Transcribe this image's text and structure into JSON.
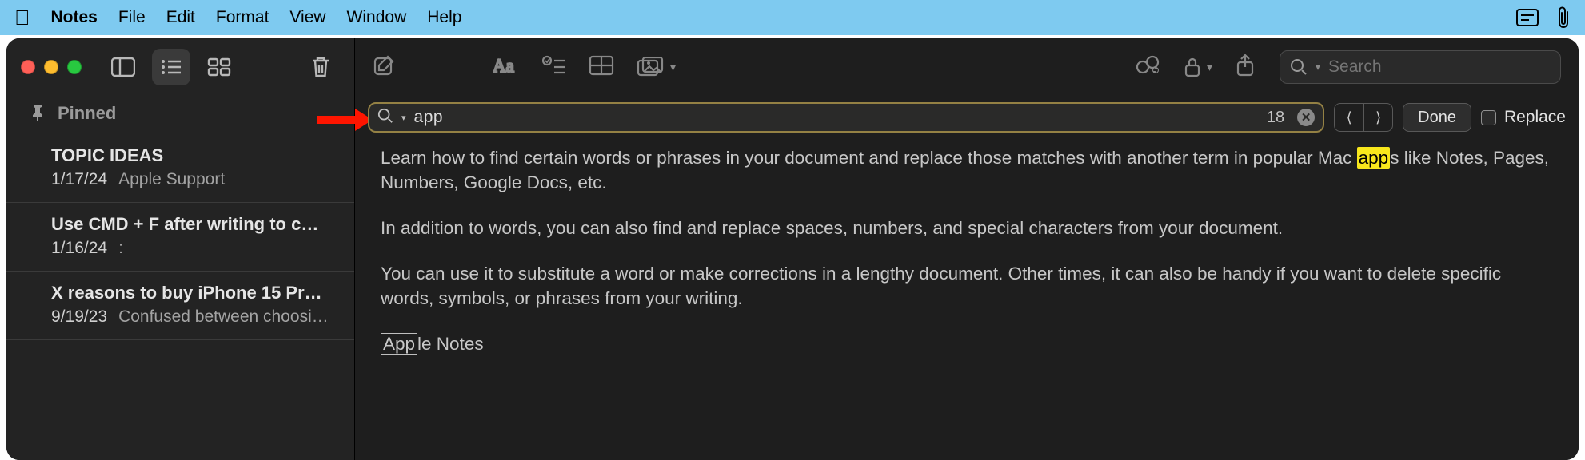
{
  "menubar": {
    "app": "Notes",
    "items": [
      "File",
      "Edit",
      "Format",
      "View",
      "Window",
      "Help"
    ]
  },
  "sidebar": {
    "pinned_label": "Pinned",
    "notes": [
      {
        "title": "TOPIC IDEAS",
        "date": "1/17/24",
        "preview": "Apple Support"
      },
      {
        "title": "Use CMD + F after writing to c…",
        "date": "1/16/24",
        "preview": ":"
      },
      {
        "title": "X reasons to buy iPhone 15 Pr…",
        "date": "9/19/23",
        "preview": "Confused between choosi…"
      }
    ]
  },
  "toolbar_search": {
    "placeholder": "Search"
  },
  "find": {
    "query": "app",
    "count": "18",
    "done_label": "Done",
    "replace_label": "Replace"
  },
  "note_body": {
    "p1_pre": "Learn how to find certain words or phrases in your document and replace those matches with another term in popular Mac ",
    "p1_hl": "app",
    "p1_post": "s like Notes, Pages, Numbers, Google Docs, etc.",
    "p2": "In addition to words, you can also find and replace spaces, numbers, and special characters from your document.",
    "p3": "You can use it to substitute a word or make corrections in a lengthy document. Other times, it can also be handy if you want to delete specific words, symbols, or phrases from your writing.",
    "p4_box": "App",
    "p4_rest": "le Notes"
  }
}
